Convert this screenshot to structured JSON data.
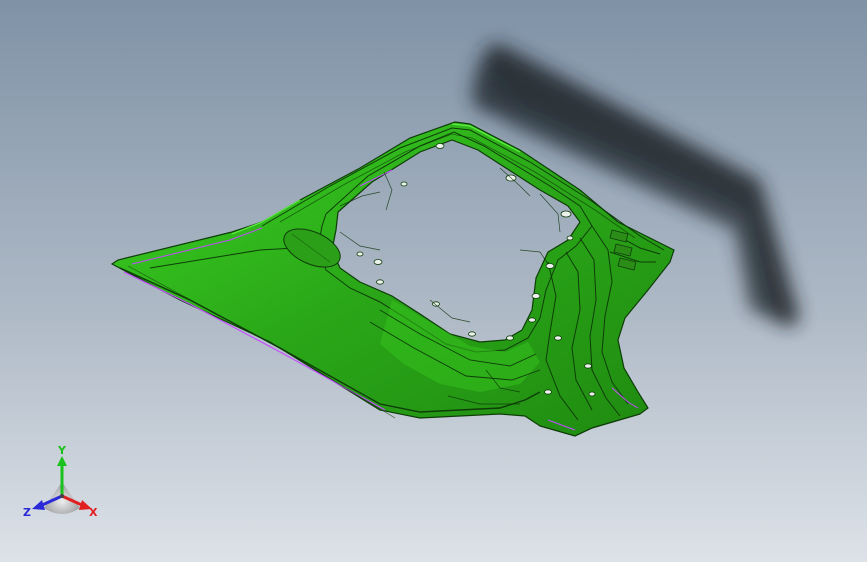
{
  "viewport": {
    "background_top": "#7f92a6",
    "background_bottom": "#dde2e8"
  },
  "model": {
    "part_color": "#2fb81a",
    "part_edge_color": "#0e3d08",
    "highlight_color": "#c44dff",
    "shadow_color": "#1c2128"
  },
  "triad": {
    "x_label": "X",
    "y_label": "Y",
    "z_label": "Z",
    "x_color": "#e02020",
    "y_color": "#19c21a",
    "z_color": "#2a2ad8"
  }
}
